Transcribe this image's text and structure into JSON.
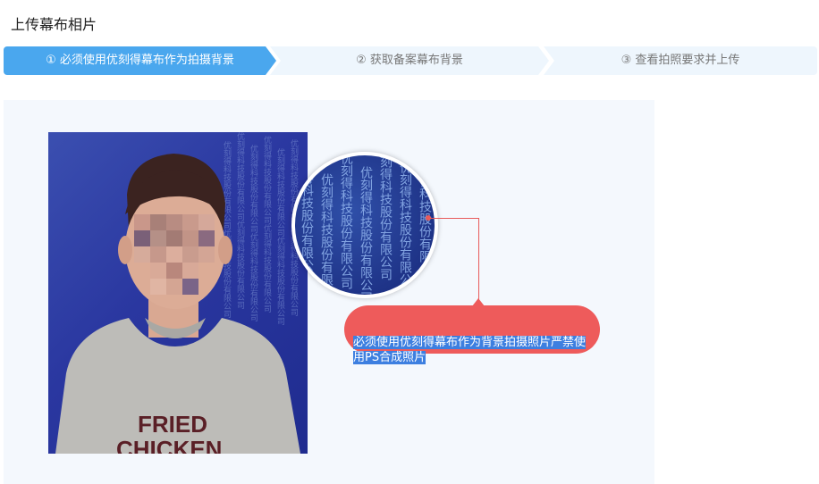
{
  "page": {
    "title": "上传幕布相片"
  },
  "steps": [
    {
      "label": "① 必须使用优刻得幕布作为拍摄背景",
      "active": true
    },
    {
      "label": "② 获取备案幕布背景",
      "active": false
    },
    {
      "label": "③ 查看拍照要求并上传",
      "active": false
    }
  ],
  "example": {
    "shirt_text_line1": "FRIED",
    "shirt_text_line2": "CHICKEN",
    "backdrop_text": "优刻得科技股份有限公司",
    "callout_text": "必须使用优刻得幕布作为背景拍摄照片严禁使用PS合成照片"
  },
  "colors": {
    "accent": "#4aa7ee",
    "callout": "#ee5b5b",
    "backdrop": "#2a37a0"
  }
}
